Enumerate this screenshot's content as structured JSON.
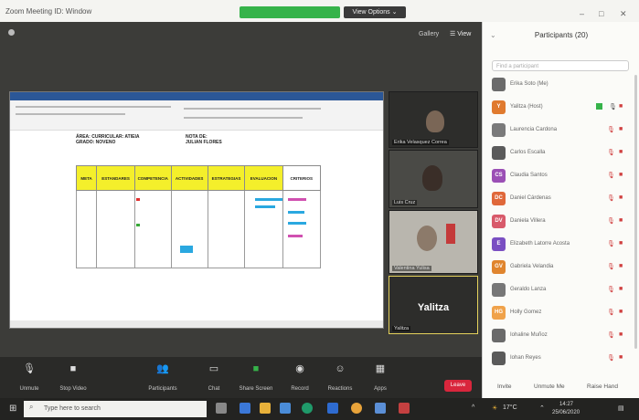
{
  "window": {
    "title": "Zoom Meeting ID: Window",
    "view_options": "View Options ⌄",
    "gallery": "Gallery",
    "view": "☰ View"
  },
  "shared_doc": {
    "header_left": [
      "ÁREA: CURRICULAR: ATIEIA",
      "GRADO: NOVENO"
    ],
    "header_right": [
      "NOTA DE:",
      "JULIAN FLORES"
    ],
    "columns": [
      "META",
      "ESTANDARES",
      "COMPETENCIA",
      "ACTIVIDADES",
      "ESTRATEGIAS",
      "EVALUACION",
      "CRITERIOS"
    ]
  },
  "participants_tiles": [
    {
      "label": "Erika Velasquez Correa"
    },
    {
      "label": "Luis Cruz"
    },
    {
      "label": "Valentina Yulisa"
    },
    {
      "label": "Yalitza",
      "bigname": "Yalitza"
    }
  ],
  "toolbar": {
    "buttons": [
      {
        "label": "Unmute",
        "icon": "microphone-icon"
      },
      {
        "label": "Stop Video",
        "icon": "video-camera-icon"
      },
      {
        "label": "Participants",
        "icon": "participants-icon"
      },
      {
        "label": "Chat",
        "icon": "chat-icon"
      },
      {
        "label": "Share Screen",
        "icon": "share-screen-icon"
      },
      {
        "label": "Record",
        "icon": "record-icon"
      },
      {
        "label": "Reactions",
        "icon": "reactions-icon"
      },
      {
        "label": "Apps",
        "icon": "apps-icon"
      }
    ],
    "leave": "Leave"
  },
  "panel": {
    "title": "Participants (20)",
    "search_placeholder": "Find a participant",
    "people": [
      {
        "name": "Erika Soto (Me)",
        "initials": "",
        "color": "#6b6b6b"
      },
      {
        "name": "Yalitza (Host)",
        "initials": "Y",
        "color": "#e07a2e"
      },
      {
        "name": "Laurencia Cardona",
        "initials": "",
        "color": "#7a7a7a"
      },
      {
        "name": "Carlos Escalla",
        "initials": "",
        "color": "#5b5b5b"
      },
      {
        "name": "Claudia Santos",
        "initials": "CS",
        "color": "#9b4fb5"
      },
      {
        "name": "Daniel Cárdenas",
        "initials": "DC",
        "color": "#e0683a"
      },
      {
        "name": "Daniela Villera",
        "initials": "DV",
        "color": "#d85a6a"
      },
      {
        "name": "Elizabeth Latorre Acosta",
        "initials": "E",
        "color": "#7a4fc2"
      },
      {
        "name": "Gabriela Velandia",
        "initials": "GV",
        "color": "#e0852e"
      },
      {
        "name": "Geraldo Lanza",
        "initials": "",
        "color": "#777777"
      },
      {
        "name": "Holly Gomez",
        "initials": "HG",
        "color": "#f0a24a"
      },
      {
        "name": "Iohaline Muñoz",
        "initials": "",
        "color": "#6a6a6a"
      },
      {
        "name": "Iohan Reyes",
        "initials": "",
        "color": "#5a5a5a"
      }
    ],
    "footer": {
      "invite": "Invite",
      "unmute_me": "Unmute Me",
      "raise_hand": "Raise Hand"
    }
  },
  "taskbar": {
    "search_placeholder": "Type here to search",
    "time": "14:27",
    "date": "25/06/2020",
    "temp": "17°C"
  }
}
